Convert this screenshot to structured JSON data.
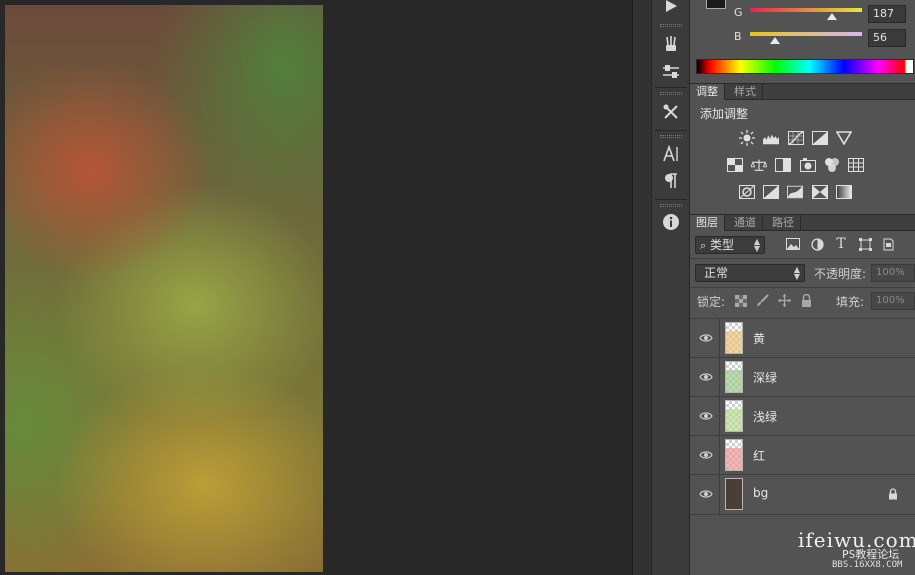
{
  "color_panel": {
    "g_label": "G",
    "g_value": "187",
    "b_label": "B",
    "b_value": "56",
    "g_level": 187,
    "b_level": 56
  },
  "adjust_panel": {
    "tabs": [
      {
        "label": "调整",
        "active": true
      },
      {
        "label": "样式",
        "active": false
      }
    ],
    "title": "添加调整"
  },
  "layers_panel": {
    "tabs": [
      {
        "label": "图层",
        "active": true
      },
      {
        "label": "通道",
        "active": false
      },
      {
        "label": "路径",
        "active": false
      }
    ],
    "filter_type": "类型",
    "blend_mode": "正常",
    "opacity_label": "不透明度:",
    "opacity_value": "100%",
    "lock_label": "锁定:",
    "fill_label": "填充:",
    "fill_value": "100%",
    "layers": [
      {
        "name": "黄",
        "tint": "#e9c27a",
        "locked": false
      },
      {
        "name": "深绿",
        "tint": "#9ccc8e",
        "locked": false
      },
      {
        "name": "浅绿",
        "tint": "#b9dc92",
        "locked": false
      },
      {
        "name": "红",
        "tint": "#ef9a94",
        "locked": false
      },
      {
        "name": "bg",
        "tint": "#4a3e35",
        "locked": true
      }
    ]
  },
  "watermark": {
    "site": "ifeiwu.com",
    "forum": "PS教程论坛",
    "bbs": "BBS.16XX8.COM"
  },
  "colors": {
    "app_bg": "#282828",
    "panel_bg": "#535353",
    "tab_bar": "#3f3f3f",
    "tool_bg": "#3b3b3b"
  }
}
